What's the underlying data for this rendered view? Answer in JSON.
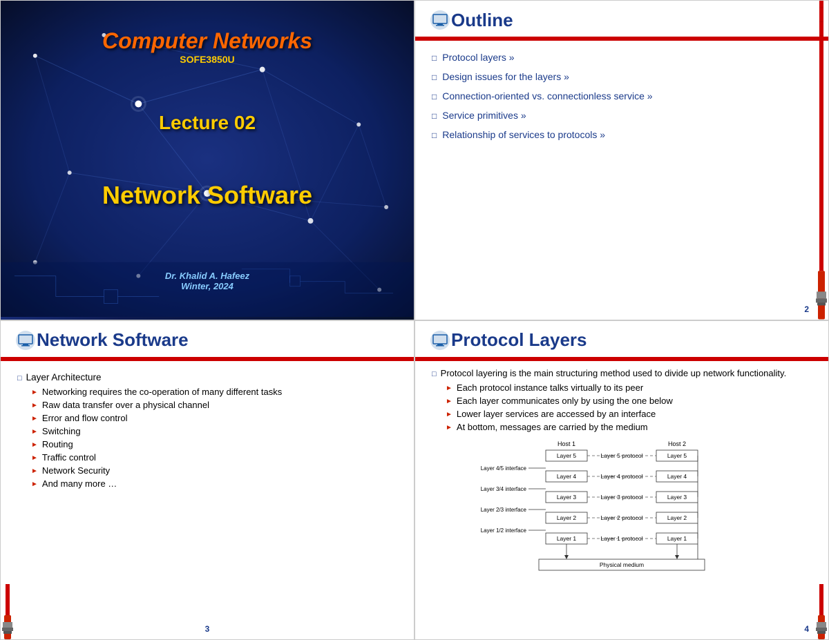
{
  "slide1": {
    "title": "Computer Networks",
    "courseCode": "SOFE3850U",
    "lectureNum": "Lecture 02",
    "lectureTitle": "Network Software",
    "author": "Dr. Khalid A. Hafeez",
    "semester": "Winter, 2024"
  },
  "slide2": {
    "headerTitle": "Outline",
    "slideNumber": "2",
    "items": [
      "Protocol layers »",
      "Design issues for the layers »",
      "Connection-oriented vs. connectionless service »",
      "Service primitives »",
      "Relationship of services to protocols »"
    ]
  },
  "slide3": {
    "headerTitle": "Network Software",
    "slideNumber": "3",
    "mainBullet": "Layer Architecture",
    "subBullets": [
      "Networking requires the co-operation of many different tasks",
      "Raw data transfer over a physical channel",
      "Error and flow control",
      "Switching",
      "Routing",
      "Traffic control",
      "Network Security",
      "And many more …"
    ]
  },
  "slide4": {
    "headerTitle": "Protocol Layers",
    "slideNumber": "4",
    "mainBullet": "Protocol layering is the main structuring method used to divide up network functionality.",
    "subBullets": [
      "Each protocol instance talks virtually to its peer",
      "Each layer communicates only by using the one below",
      "Lower layer services are accessed by an interface",
      "At bottom, messages are carried by the medium"
    ],
    "diagram": {
      "host1Label": "Host 1",
      "host2Label": "Host 2",
      "layers": [
        "Layer 5",
        "Layer 4",
        "Layer 3",
        "Layer 2",
        "Layer 1"
      ],
      "protocols": [
        "Layer 5 protocol",
        "Layer 4 protocol",
        "Layer 3 protocol",
        "Layer 2 protocol",
        "Layer 1 protocol"
      ],
      "interfaces": [
        "Layer 4/5 interface",
        "Layer 3/4 interface",
        "Layer 2/3 interface",
        "Layer 1/2 interface"
      ],
      "physicalMedium": "Physical medium"
    }
  }
}
